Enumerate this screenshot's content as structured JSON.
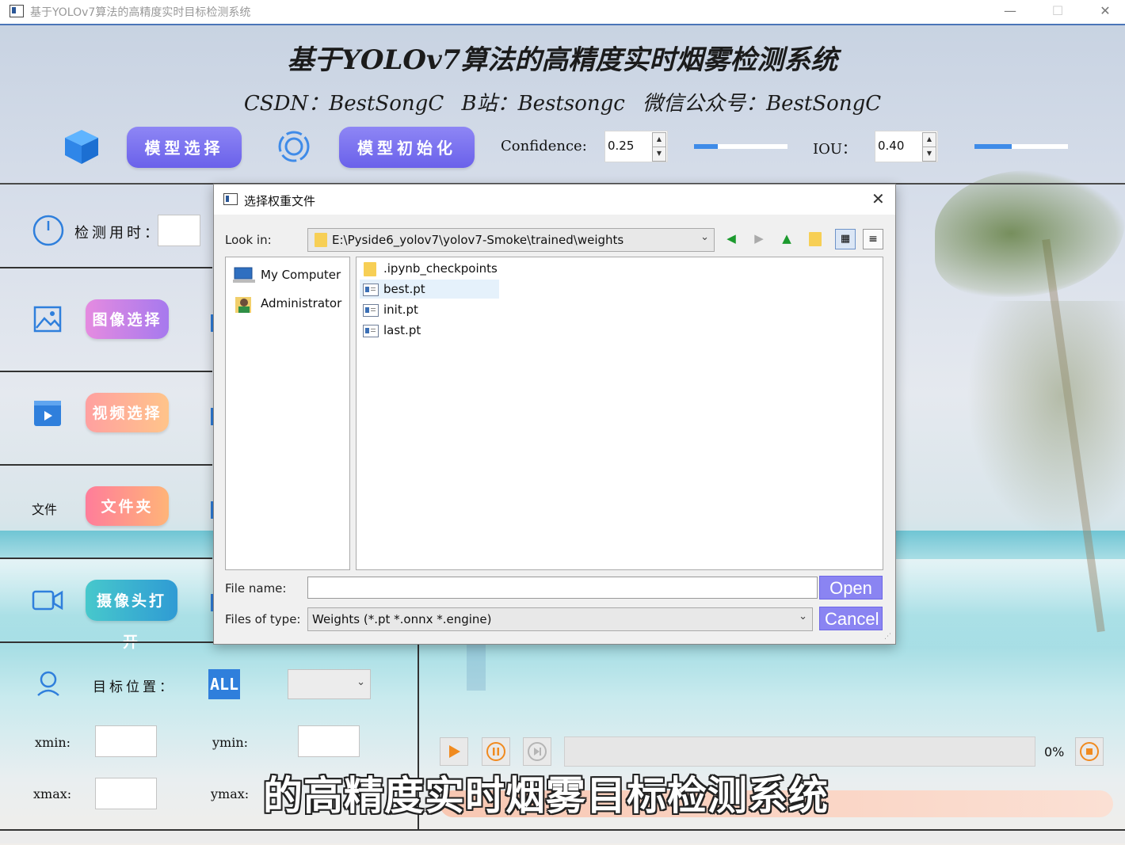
{
  "window": {
    "title": "基于YOLOv7算法的高精度实时目标检测系统",
    "minimize": "—",
    "maximize": "☐",
    "close": "✕"
  },
  "header": {
    "title": "基于YOLOv7算法的高精度实时烟雾检测系统",
    "subtitle": "CSDN：BestSongC  B站：Bestsongc  微信公众号：BestSongC"
  },
  "toolbar": {
    "model_select": "模型选择",
    "model_init": "模型初始化",
    "confidence_label": "Confidence:",
    "confidence_value": "0.25",
    "confidence_level": 0.25,
    "iou_label": "IOU：",
    "iou_value": "0.40",
    "iou_level": 0.4
  },
  "sidebar": {
    "detect_time_label": "检测用时：",
    "image_select": "图像选择",
    "video_select": "视频选择",
    "folder_icon_label": "文件",
    "folder_select": "文件夹",
    "camera_open": "摄像头打开",
    "target_pos_label": "目标位置：",
    "all_badge": "ALL",
    "xmin": "xmin:",
    "ymin": "ymin:",
    "xmax": "xmax:",
    "ymax": "ymax:"
  },
  "dialog": {
    "title": "选择权重文件",
    "look_in_label": "Look in:",
    "look_in_path": "E:\\Pyside6_yolov7\\yolov7-Smoke\\trained\\weights",
    "places": [
      {
        "label": "My Computer"
      },
      {
        "label": "Administrator"
      }
    ],
    "files": [
      {
        "name": ".ipynb_checkpoints",
        "type": "folder"
      },
      {
        "name": "best.pt",
        "type": "file"
      },
      {
        "name": "init.pt",
        "type": "file"
      },
      {
        "name": "last.pt",
        "type": "file"
      }
    ],
    "file_name_label": "File name:",
    "file_name_value": "",
    "file_type_label": "Files of type:",
    "file_type_value": "Weights (*.pt *.onnx *.engine)",
    "open": "Open",
    "cancel": "Cancel"
  },
  "player": {
    "progress_text": "0%",
    "progress": 0
  },
  "overlay": {
    "caption": "的高精度实时烟雾目标检测系统"
  },
  "colors": {
    "accent_blue": "#2f7fdc",
    "purple": "#7a72ef",
    "dialog_button": "#8a84f2"
  }
}
